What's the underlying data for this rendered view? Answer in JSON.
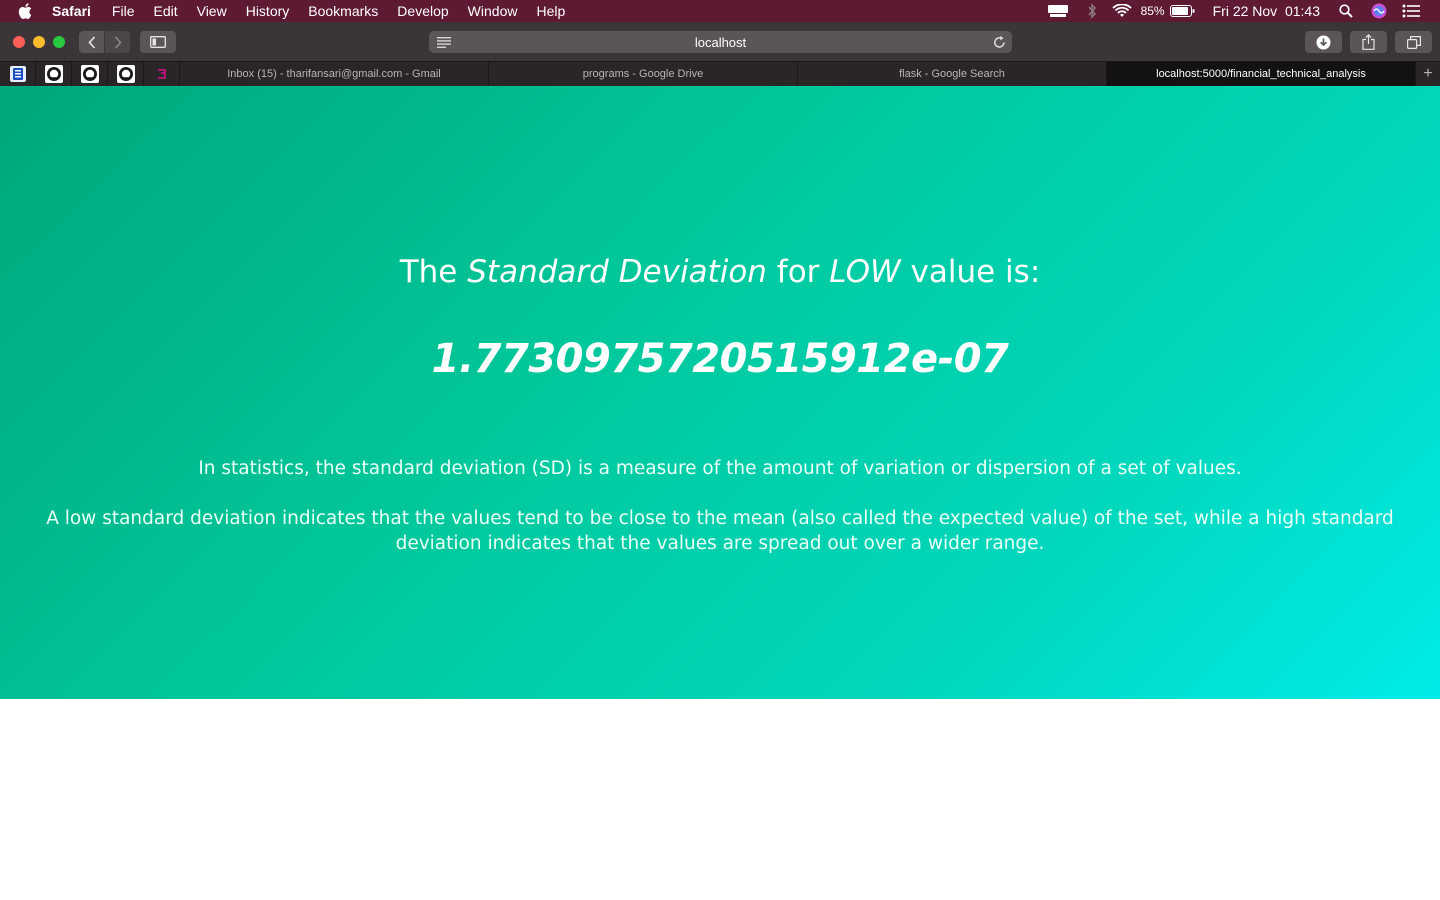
{
  "menubar": {
    "app": "Safari",
    "items": [
      "File",
      "Edit",
      "View",
      "History",
      "Bookmarks",
      "Develop",
      "Window",
      "Help"
    ],
    "battery": "85%",
    "datetime": "Fri 22 Nov  01:43"
  },
  "toolbar": {
    "address": "localhost"
  },
  "tabs": [
    {
      "label": "Inbox (15) - tharifansari@gmail.com - Gmail"
    },
    {
      "label": "programs - Google Drive"
    },
    {
      "label": "flask - Google Search"
    },
    {
      "label": "localhost:5000/financial_technical_analysis"
    }
  ],
  "new_tab_label": "+",
  "content": {
    "heading_the": "The ",
    "heading_sd": "Standard Deviation",
    "heading_for": " for ",
    "heading_low": "LOW",
    "heading_rest": " value is:",
    "value": "1.7730975720515912e-07",
    "para1": "In statistics, the standard deviation (SD) is a measure of the amount of variation or dispersion of a set of values.",
    "para2": "A low standard deviation indicates that the values tend to be close to the mean (also called the expected value) of the set, while a high standard deviation indicates that the values are spread out over a wider range."
  },
  "colors": {
    "menubar": "#5e1a33",
    "gradient_start": "#00a77b",
    "gradient_end": "#00ebe8"
  }
}
